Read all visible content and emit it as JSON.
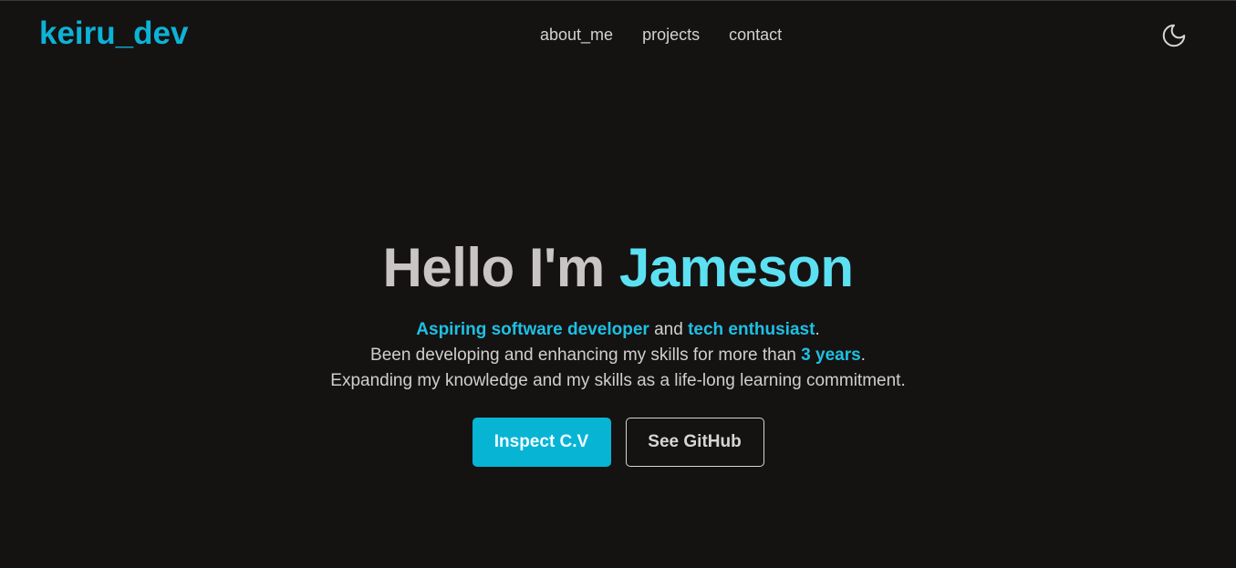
{
  "colors": {
    "background": "#151212",
    "accent": "#0cb3d6",
    "name_accent": "#5ce1f2",
    "text": "#cfcfcf"
  },
  "header": {
    "brand": "keiru_dev",
    "nav": [
      {
        "label": "about_me"
      },
      {
        "label": "projects"
      },
      {
        "label": "contact"
      }
    ],
    "theme_icon": "moon-icon"
  },
  "hero": {
    "greeting": "Hello I'm ",
    "name": "Jameson",
    "line1": {
      "part1": "Aspiring software developer",
      "part2": " and ",
      "part3": "tech enthusiast",
      "part4": "."
    },
    "line2": {
      "part1": "Been developing and enhancing my skills for more than ",
      "part2": "3 years",
      "part3": "."
    },
    "line3": "Expanding my knowledge and my skills as a life-long learning commitment.",
    "primary_button": "Inspect C.V",
    "secondary_button": "See GitHub"
  }
}
